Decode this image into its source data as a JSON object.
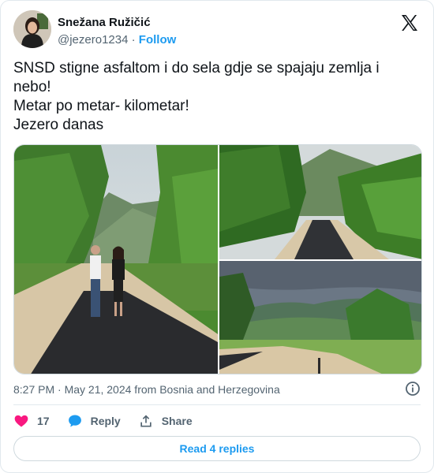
{
  "author": {
    "display_name": "Snežana Ružičić",
    "handle": "@jezero1234",
    "separator": "·",
    "follow_label": "Follow"
  },
  "icons": {
    "brand": "x-logo-icon",
    "info": "info-icon",
    "like": "heart-icon",
    "reply": "speech-bubble-icon",
    "share": "share-arrow-icon"
  },
  "tweet": {
    "text": "SNSD stigne asfaltom i do sela gdje se spajaju zemlja i\nnebo!\nMetar po metar- kilometar!\nJezero danas",
    "timestamp": "8:27 PM · May 21, 2024 from Bosnia and Herzegovina"
  },
  "media": {
    "count": 3,
    "photos": [
      {
        "subject": "man and woman standing on new asphalt road"
      },
      {
        "subject": "fresh asphalt road through forest"
      },
      {
        "subject": "newly paved road with mountain view"
      }
    ]
  },
  "actions": {
    "like_count": "17",
    "reply_label": "Reply",
    "share_label": "Share"
  },
  "replies": {
    "read_label": "Read 4 replies"
  },
  "colors": {
    "accent": "#1d9bf0",
    "like": "#f91880",
    "text": "#0f1419",
    "muted": "#536471"
  }
}
